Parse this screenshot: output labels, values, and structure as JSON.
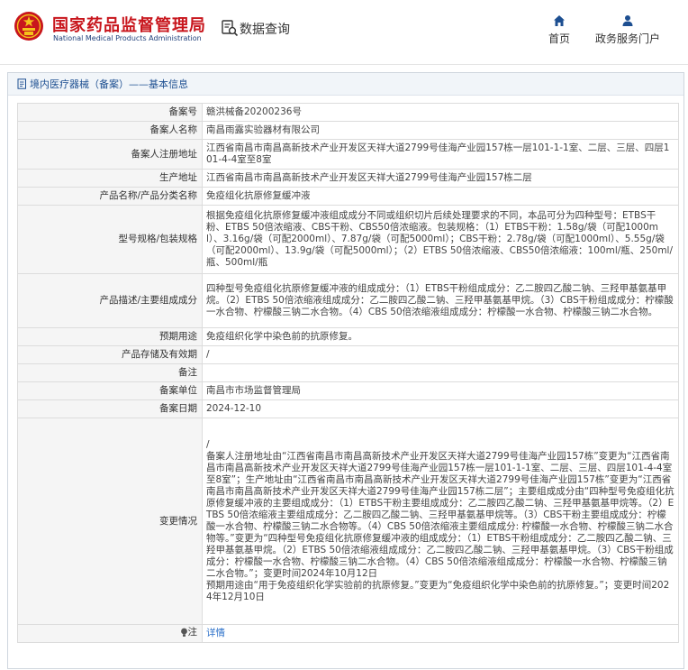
{
  "header": {
    "brand_cn": "国家药品监督管理局",
    "brand_en": "National Medical Products Administration",
    "query_label": "数据查询",
    "nav": {
      "home": "首页",
      "service": "政务服务门户"
    }
  },
  "breadcrumb": "境内医疗器械（备案）——基本信息",
  "rows": [
    {
      "key": "备案号",
      "value": "赣洪械备20200236号"
    },
    {
      "key": "备案人名称",
      "value": "南昌雨露实验器材有限公司"
    },
    {
      "key": "备案人注册地址",
      "value": "江西省南昌市南昌高新技术产业开发区天祥大道2799号佳海产业园157栋一层101-1-1室、二层、三层、四层101-4-4室至8室"
    },
    {
      "key": "生产地址",
      "value": "江西省南昌市南昌高新技术产业开发区天祥大道2799号佳海产业园157栋二层"
    },
    {
      "key": "产品名称/产品分类名称",
      "value": "免疫组化抗原修复缓冲液"
    },
    {
      "key": "型号规格/包装规格",
      "value": "根据免疫组化抗原修复缓冲液组成成分不同或组织切片后续处理要求的不同，本品可分为四种型号：ETBS干粉、ETBS 50倍浓缩液、CBS干粉、CBS50倍浓缩液。包装规格：（1）ETBS干粉：1.58g/袋（可配1000ml）、3.16g/袋（可配2000ml）、7.87g/袋（可配5000ml）；CBS干粉：2.78g/袋（可配1000ml）、5.55g/袋（可配2000ml）、13.9g/袋（可配5000ml）；（2）ETBS 50倍浓缩液、CBS50倍浓缩液：100ml/瓶、250ml/瓶、500ml/瓶"
    },
    {
      "key": "产品描述/主要组成成分",
      "value": "四种型号免疫组化抗原修复缓冲液的组成成分：（1）ETBS干粉组成成分：乙二胺四乙酸二钠、三羟甲基氨基甲烷。（2）ETBS 50倍浓缩液组成成分：乙二胺四乙酸二钠、三羟甲基氨基甲烷。（3）CBS干粉组成成分：柠檬酸一水合物、柠檬酸三钠二水合物。（4）CBS 50倍浓缩液组成成分：柠檬酸一水合物、柠檬酸三钠二水合物。"
    },
    {
      "key": "预期用途",
      "value": "免疫组织化学中染色前的抗原修复。"
    },
    {
      "key": "产品存储及有效期",
      "value": "/"
    },
    {
      "key": "备注",
      "value": ""
    },
    {
      "key": "备案单位",
      "value": "南昌市市场监督管理局"
    },
    {
      "key": "备案日期",
      "value": "2024-12-10"
    }
  ],
  "change": {
    "key": "变更情况",
    "value": "/\n备案人注册地址由“江西省南昌市南昌高新技术产业开发区天祥大道2799号佳海产业园157栋”变更为“江西省南昌市南昌高新技术产业开发区天祥大道2799号佳海产业园157栋一层101-1-1室、二层、三层、四层101-4-4室至8室”；生产地址由“江西省南昌市南昌高新技术产业开发区天祥大道2799号佳海产业园157栋”变更为“江西省南昌市南昌高新技术产业开发区天祥大道2799号佳海产业园157栋二层”；主要组成成分由“四种型号免疫组化抗原修复缓冲液的主要组成成分：（1）ETBS干粉主要组成成分：乙二胺四乙酸二钠、三羟甲基氨基甲烷等。（2）ETBS 50倍浓缩液主要组成成分：乙二胺四乙酸二钠、三羟甲基氨基甲烷等。（3）CBS干粉主要组成成分：柠檬酸一水合物、柠檬酸三钠二水合物等。（4）CBS 50倍浓缩液主要组成成分: 柠檬酸一水合物、柠檬酸三钠二水合物等。”变更为“四种型号免疫组化抗原修复缓冲液的组成成分：（1）ETBS干粉组成成分：乙二胺四乙酸二钠、三羟甲基氨基甲烷。（2）ETBS 50倍浓缩液组成成分：乙二胺四乙酸二钠、三羟甲基氨基甲烷。（3）CBS干粉组成成分：柠檬酸一水合物、柠檬酸三钠二水合物。（4）CBS 50倍浓缩液组成成分：柠檬酸一水合物、柠檬酸三钠二水合物。”；变更时间2024年10月12日\n预期用途由“用于免疫组织化学实验前的抗原修复。”变更为“免疫组织化学中染色前的抗原修复。”；变更时间2024年12月10日"
  },
  "note": {
    "key": "注",
    "link": "详情"
  },
  "colors": {
    "brand_red": "#c8161d",
    "nav_blue": "#1d4f91",
    "link_blue": "#2b70c9"
  },
  "icons": [
    "national-emblem-icon",
    "data-query-icon",
    "home-icon",
    "user-icon",
    "document-icon",
    "lightbulb-icon"
  ]
}
